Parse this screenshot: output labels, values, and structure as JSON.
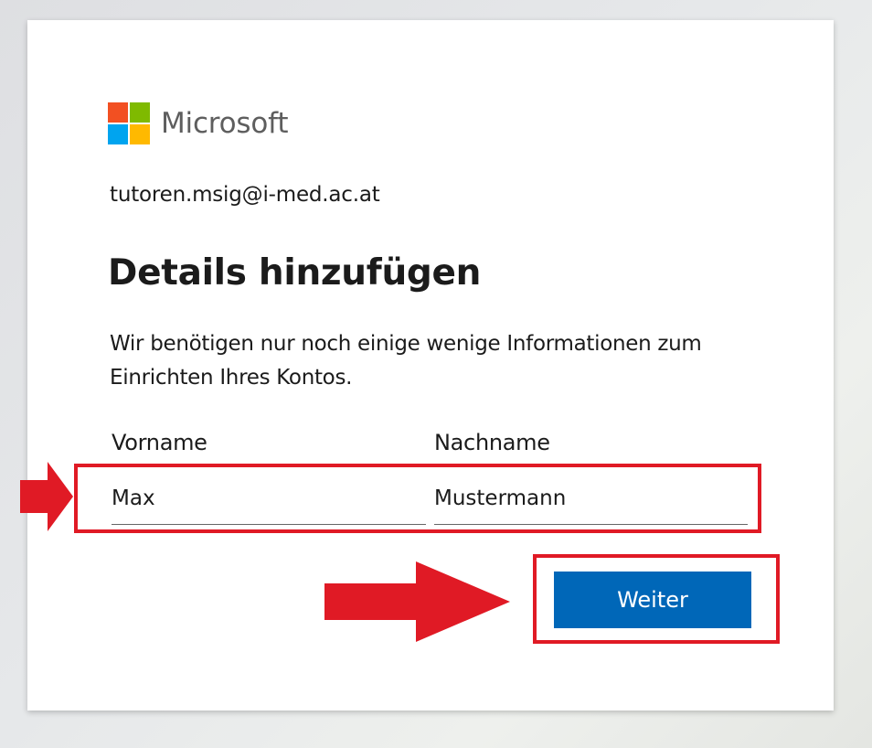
{
  "brand": {
    "name": "Microsoft",
    "logo_colors": [
      "#f25022",
      "#7fba00",
      "#00a4ef",
      "#ffb900"
    ]
  },
  "account": {
    "email": "tutoren.msig@i-med.ac.at"
  },
  "form": {
    "title": "Details hinzufügen",
    "description": "Wir benötigen nur noch einige wenige Informationen zum Einrichten Ihres Kontos.",
    "first_name": {
      "label": "Vorname",
      "value": "Max"
    },
    "last_name": {
      "label": "Nachname",
      "value": "Mustermann"
    },
    "submit_label": "Weiter"
  },
  "annotations": {
    "highlight_color": "#e01a25",
    "button_color": "#0067b8"
  }
}
